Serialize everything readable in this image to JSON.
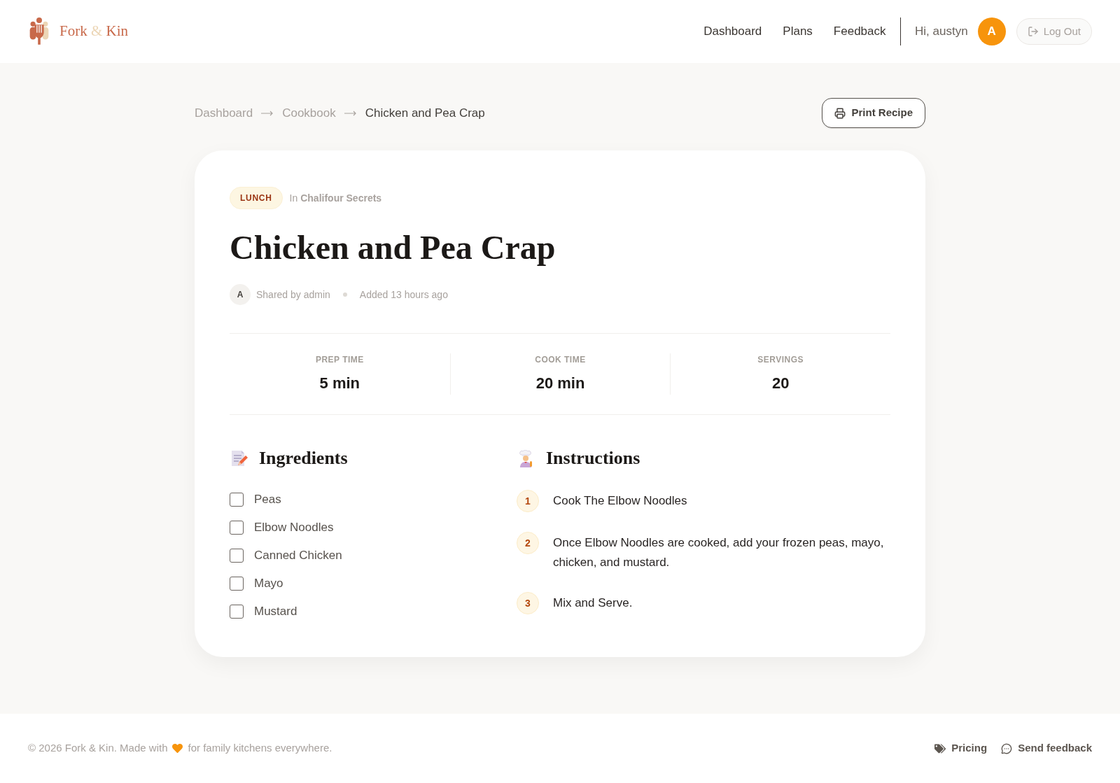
{
  "brand": {
    "first": "Fork",
    "joiner": "&",
    "last": "Kin"
  },
  "nav": [
    "Dashboard",
    "Plans",
    "Feedback"
  ],
  "user": {
    "greeting": "Hi, austyn",
    "avatar_initial": "A"
  },
  "logout_button": "Log Out",
  "breadcrumb": [
    {
      "label": "Dashboard",
      "current": false
    },
    {
      "label": "Cookbook",
      "current": false
    },
    {
      "label": "Chicken and Pea Crap",
      "current": true
    }
  ],
  "print_button": "Print Recipe",
  "recipe": {
    "category": "LUNCH",
    "collection": "In **Chalifour Secrets**",
    "title": "Chicken and Pea Crap",
    "author_initial": "A",
    "shared_by": "Shared by admin",
    "added": "Added 13 hours ago"
  },
  "stats": [
    {
      "label": "PREP TIME",
      "value": "5 min"
    },
    {
      "label": "COOK TIME",
      "value": "20 min"
    },
    {
      "label": "SERVINGS",
      "value": "20"
    }
  ],
  "ingredients": {
    "heading": "Ingredients",
    "items": [
      {
        "name": "Peas",
        "checked": false
      },
      {
        "name": "Elbow Noodles",
        "checked": false
      },
      {
        "name": "Canned Chicken",
        "checked": false
      },
      {
        "name": "Mayo",
        "checked": false
      },
      {
        "name": "Mustard",
        "checked": false
      }
    ]
  },
  "instructions": {
    "heading": "Instructions",
    "steps": [
      {
        "number": "1",
        "text": "Cook The Elbow Noodles"
      },
      {
        "number": "2",
        "text": "Once Elbow Noodles are cooked, add your frozen peas, mayo, chicken, and mustard."
      },
      {
        "number": "3",
        "text": "Mix and Serve."
      }
    ]
  },
  "footer": {
    "copyright": "© 2026 Fork & Kin. Made with",
    "tagline": "for family kitchens everywhere.",
    "links": [
      "Pricing",
      "Send feedback"
    ]
  }
}
